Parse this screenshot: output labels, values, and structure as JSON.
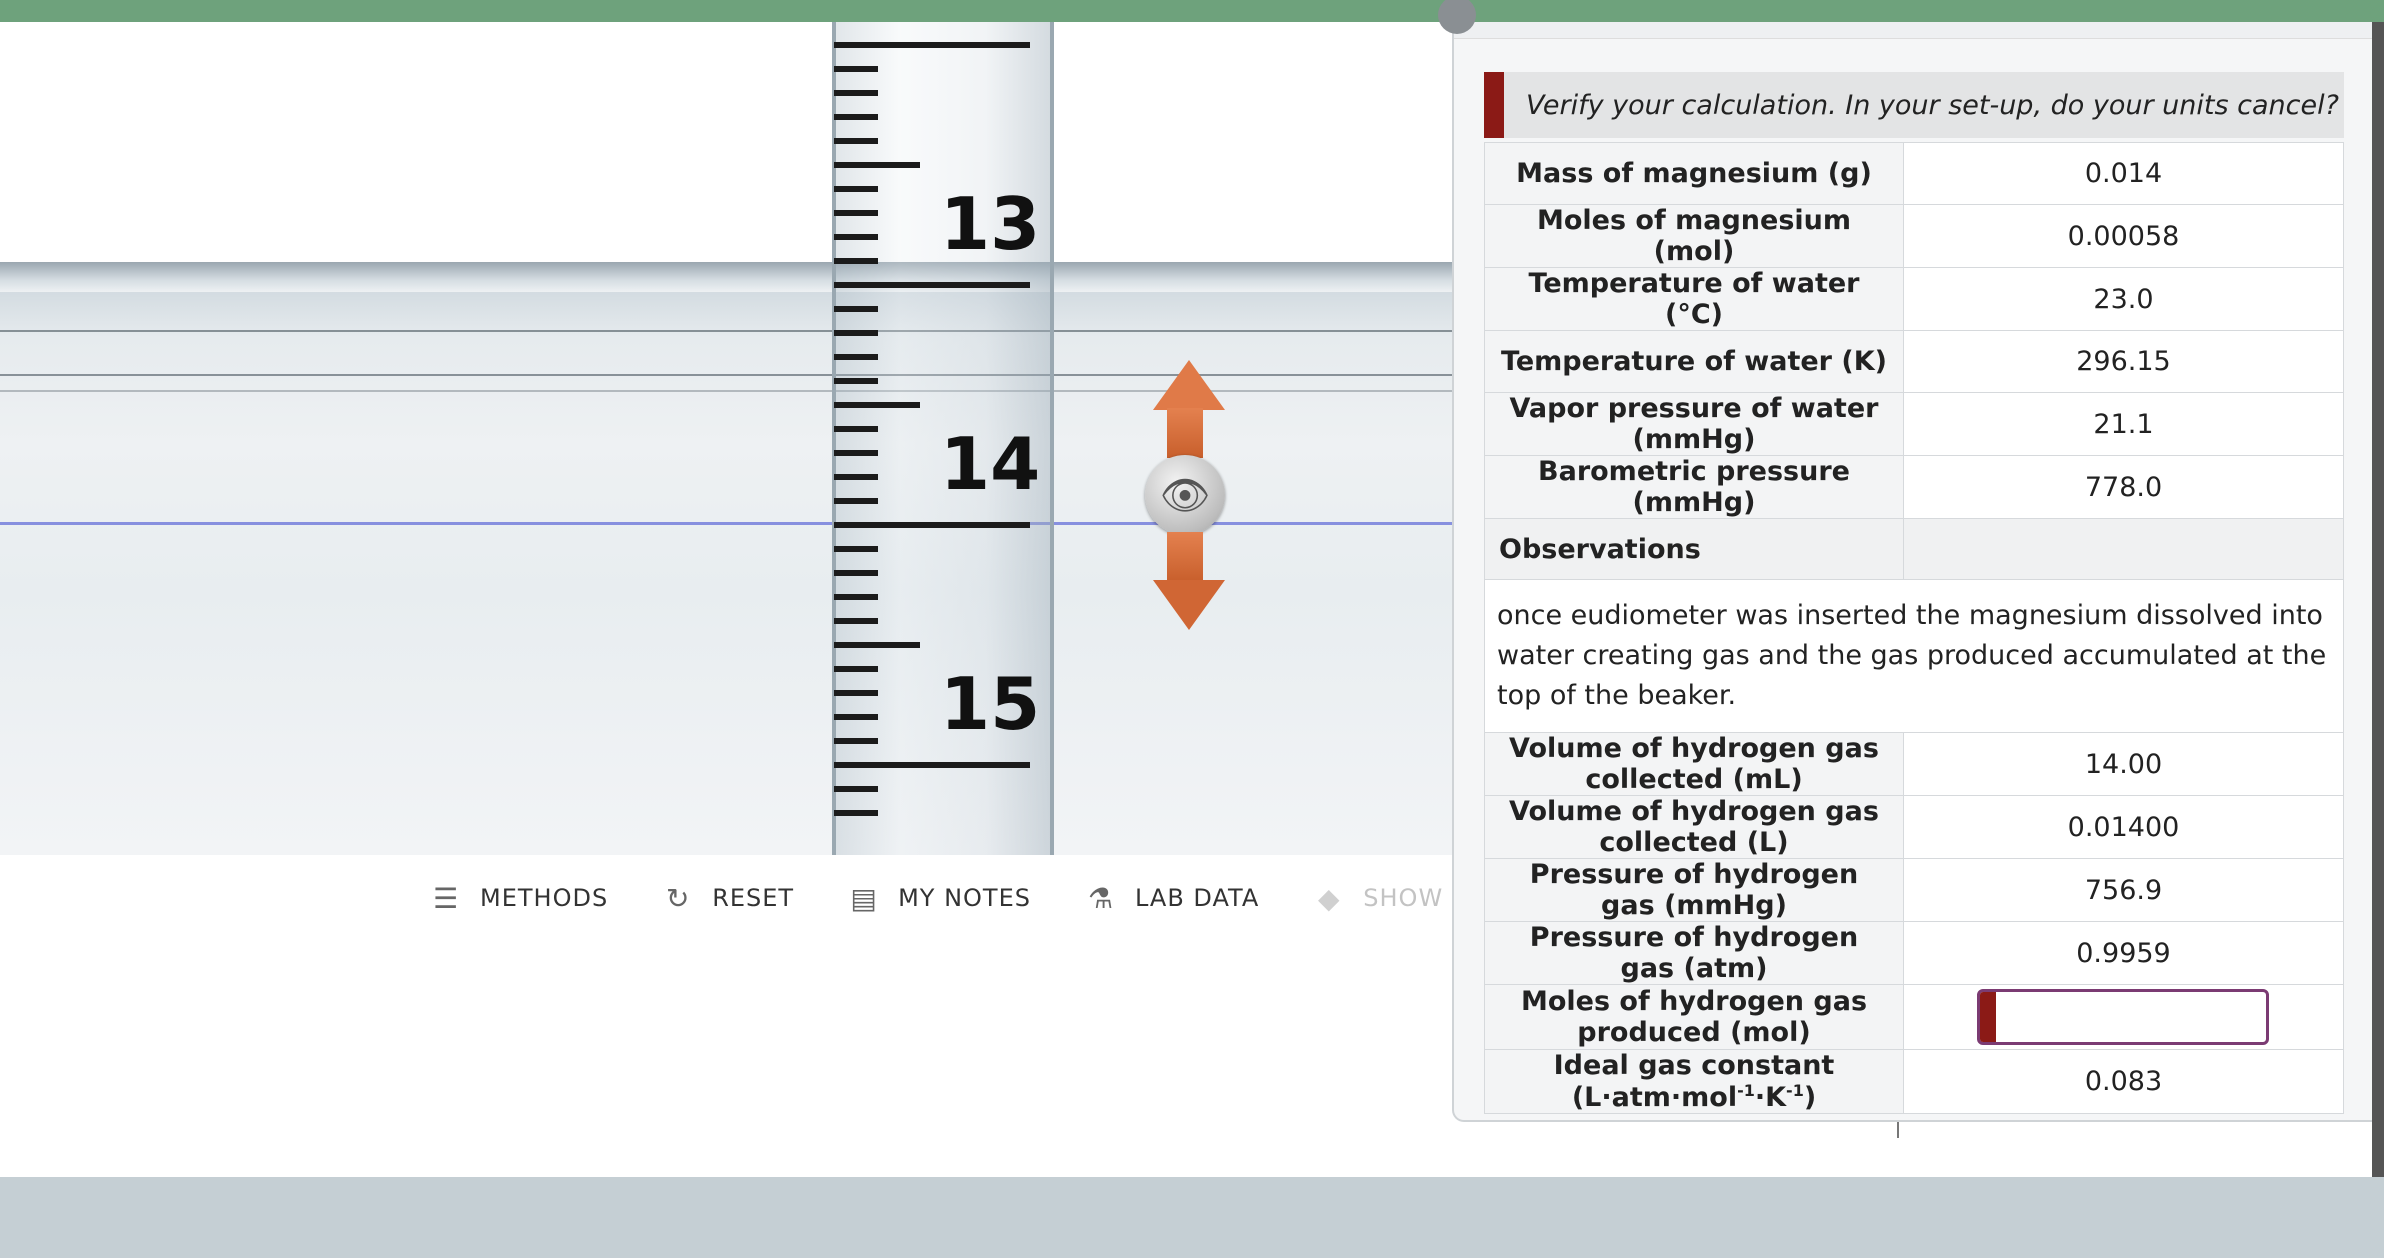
{
  "ruler": {
    "numbers": [
      "13",
      "14",
      "15"
    ]
  },
  "toolbar": {
    "methods": "METHODS",
    "reset": "RESET",
    "notes": "MY NOTES",
    "lab_data": "LAB DATA",
    "show_labels": "SHOW L"
  },
  "panel": {
    "banner": "Verify your calculation. In your set-up, do your units cancel?",
    "rows": [
      {
        "label": "Mass of magnesium (g)",
        "value": "0.014"
      },
      {
        "label": "Moles of magnesium (mol)",
        "value": "0.00058"
      },
      {
        "label": "Temperature of water (°C)",
        "value": "23.0"
      },
      {
        "label": "Temperature of water (K)",
        "value": "296.15"
      },
      {
        "label": "Vapor pressure of water (mmHg)",
        "value": "21.1"
      },
      {
        "label": "Barometric pressure (mmHg)",
        "value": "778.0"
      }
    ],
    "observations_label": "Observations",
    "observations_text": "once eudiometer was inserted the magnesium dissolved into water creating gas and the gas produced accumulated at the top of the beaker.",
    "rows2": [
      {
        "label": "Volume of hydrogen gas collected (mL)",
        "value": "14.00"
      },
      {
        "label": "Volume of hydrogen gas collected (L)",
        "value": "0.01400"
      },
      {
        "label": "Pressure of hydrogen gas (mmHg)",
        "value": "756.9"
      },
      {
        "label": "Pressure of hydrogen gas (atm)",
        "value": "0.9959"
      }
    ],
    "moles_label": "Moles of hydrogen gas produced (mol)",
    "moles_value": "",
    "gas_const_label_pre": "Ideal gas constant (L·atm·mol",
    "gas_const_sup1": "-1",
    "gas_const_mid": "·K",
    "gas_const_sup2": "-1",
    "gas_const_post": ")",
    "gas_const_value": "0.083"
  },
  "colors": {
    "topbar": "#6ea27c",
    "accent_red": "#8b1a16",
    "input_border": "#7b3b73",
    "arrow": "#e07a48"
  }
}
